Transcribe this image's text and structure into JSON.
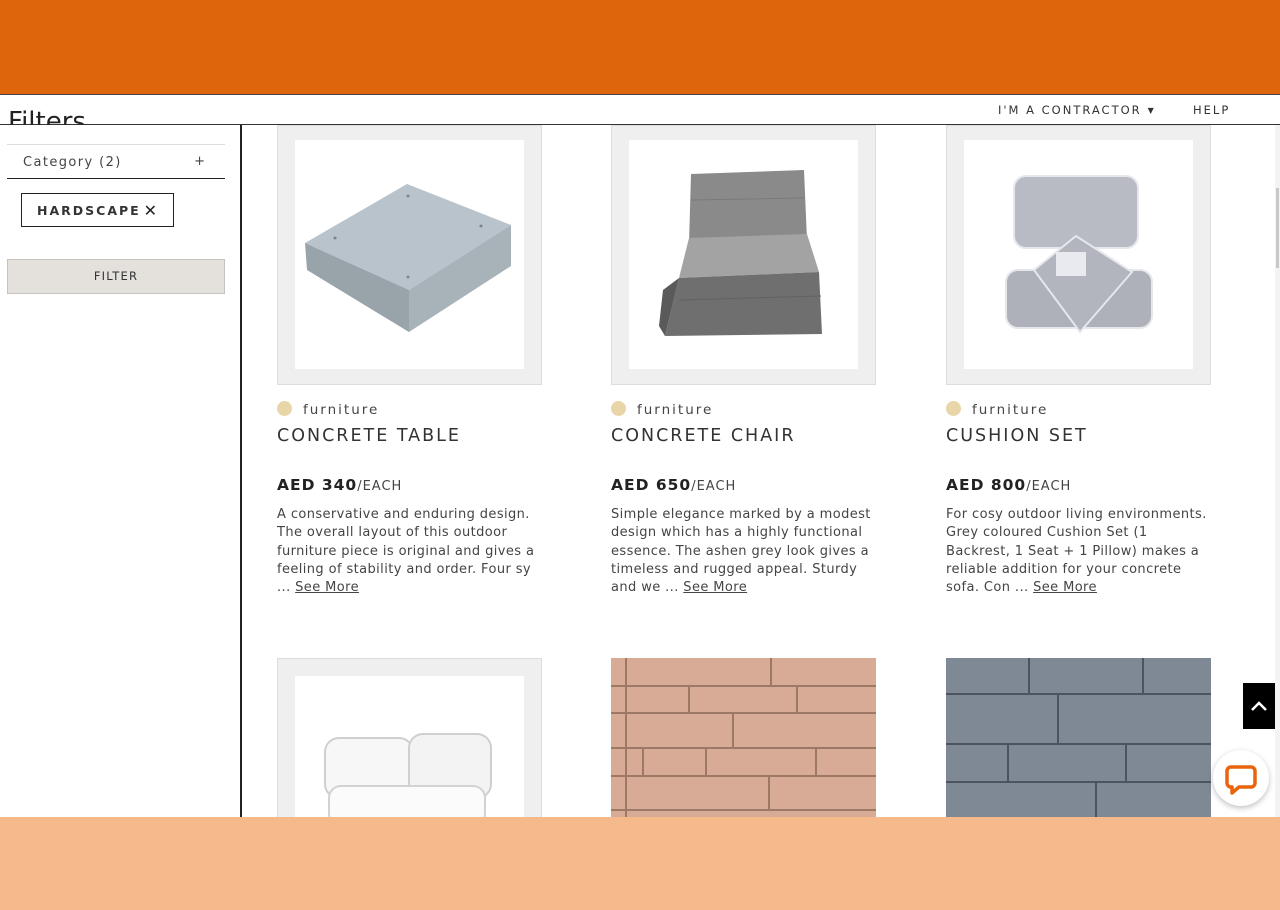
{
  "nav": {
    "contractor_label": "I'M A CONTRACTOR",
    "help_label": "HELP"
  },
  "sidebar": {
    "title": "Filters",
    "category_label": "Category (2)",
    "category_toggle": "+",
    "active_filter": "HARDSCAPE",
    "remove_symbol": "✕",
    "filter_button": "FILTER"
  },
  "products": [
    {
      "category": "furniture",
      "name": "CONCRETE TABLE",
      "price": "AED 340",
      "unit": "/EACH",
      "description": "A conservative and enduring design. The overall layout of this outdoor furniture piece is original and gives a feeling of stability and order. Four sy ...",
      "see_more": "See More"
    },
    {
      "category": "furniture",
      "name": "CONCRETE CHAIR",
      "price": "AED 650",
      "unit": "/EACH",
      "description": "Simple elegance marked by a modest design which has a highly functional essence. The ashen grey look gives a timeless and rugged appeal. Sturdy and we ...",
      "see_more": "See More"
    },
    {
      "category": "furniture",
      "name": "CUSHION SET",
      "price": "AED 800",
      "unit": "/EACH",
      "description": "For cosy outdoor living environments. Grey coloured Cushion Set (1 Backrest, 1 Seat + 1 Pillow) makes a reliable addition for your concrete sofa. Con ...",
      "see_more": "See More"
    }
  ],
  "colors": {
    "banner": "#dd650c",
    "bottom_band": "#f5b98b",
    "category_dot": "#e9d6a8",
    "chat_accent": "#e8650d"
  },
  "icons": {
    "scroll_top": "chevron-up-icon",
    "chat": "chat-bubble-icon"
  }
}
